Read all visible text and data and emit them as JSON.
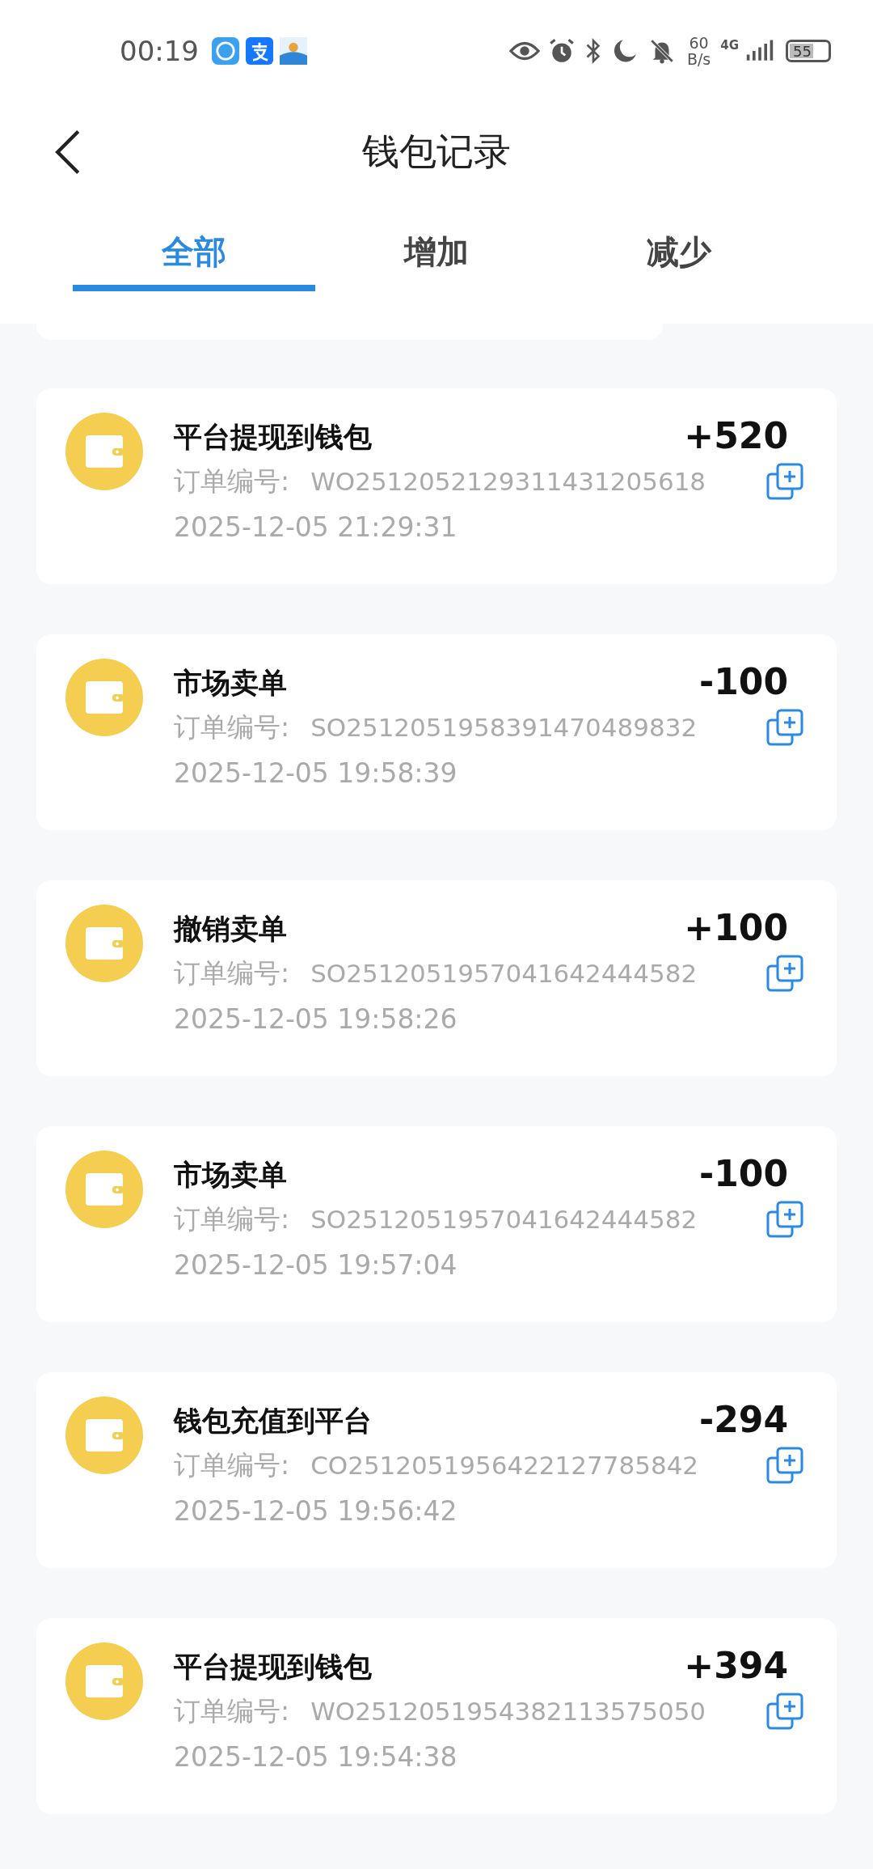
{
  "status_bar": {
    "time": "00:19",
    "net_speed": "60",
    "net_unit": "B/s",
    "network": "4G",
    "battery": "55"
  },
  "header": {
    "title": "钱包记录"
  },
  "tabs": [
    {
      "label": "全部",
      "selected": true
    },
    {
      "label": "增加",
      "selected": false
    },
    {
      "label": "减少",
      "selected": false
    }
  ],
  "records": [
    {
      "title": "平台提现到钱包",
      "amount": "+520",
      "order_label": "订单编号:",
      "order_no": "WO2512052129311431205618",
      "time": "2025-12-05 21:29:31"
    },
    {
      "title": "市场卖单",
      "amount": "-100",
      "order_label": "订单编号:",
      "order_no": "SO2512051958391470489832",
      "time": "2025-12-05 19:58:39"
    },
    {
      "title": "撤销卖单",
      "amount": "+100",
      "order_label": "订单编号:",
      "order_no": "SO2512051957041642444582",
      "time": "2025-12-05 19:58:26"
    },
    {
      "title": "市场卖单",
      "amount": "-100",
      "order_label": "订单编号:",
      "order_no": "SO2512051957041642444582",
      "time": "2025-12-05 19:57:04"
    },
    {
      "title": "钱包充值到平台",
      "amount": "-294",
      "order_label": "订单编号:",
      "order_no": "CO2512051956422127785842",
      "time": "2025-12-05 19:56:42"
    },
    {
      "title": "平台提现到钱包",
      "amount": "+394",
      "order_label": "订单编号:",
      "order_no": "WO2512051954382113575050",
      "time": "2025-12-05 19:54:38"
    }
  ]
}
